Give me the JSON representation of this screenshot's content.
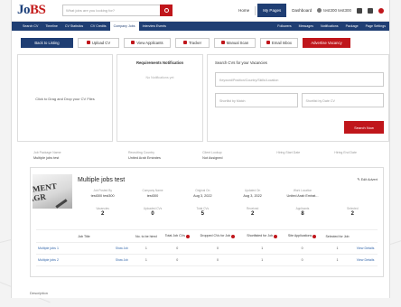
{
  "header": {
    "logo_prefix": "Jo",
    "logo_accent": "BS",
    "search_placeholder": "What jobs are you looking for?",
    "nav": [
      "Home",
      "My Pages",
      "Dashboard"
    ],
    "active_nav": "My Pages",
    "user_name": "test300 test300"
  },
  "subnav": {
    "left": [
      "Search CV",
      "Timeline",
      "CV Statistics",
      "CV Credits",
      "Company Jobs",
      "Interview Events"
    ],
    "active": "Company Jobs",
    "right": [
      "Followers",
      "Messages",
      "Notifications",
      "Package",
      "Page Settings"
    ]
  },
  "actions": {
    "back": "Back to Listing",
    "upload": "Upload CV",
    "view_applicants": "View Applicants",
    "tracker": "Tracker",
    "manual_scan": "Manual Scan",
    "email_inbox": "Email Inbox",
    "advertise": "Advertise Vacancy"
  },
  "panels": {
    "drop_text": "Click to Drag and Drop your CV Files",
    "notif_title": "Requirements Notification",
    "notif_empty": "No Notifications yet",
    "search_title": "Search CVs for your Vacancies",
    "keyword_placeholder": "Keyword/Position/Country/Skills/Location",
    "from_placeholder": "Shortlist by Match",
    "to_placeholder": "Shortlist by Date CV",
    "search_button": "Search Now"
  },
  "strip": [
    {
      "label": "Job Package Name",
      "value": "Multiple jobs test"
    },
    {
      "label": "Recruiting Country",
      "value": "United Arab Emirates"
    },
    {
      "label": "Client Lookup",
      "value": "Not Assigned"
    },
    {
      "label": "Hiring Start Date",
      "value": ""
    },
    {
      "label": "Hiring End Date",
      "value": ""
    }
  ],
  "job": {
    "title": "Multiple jobs test",
    "edit": "Edit Advert",
    "thumb_text": "YMENT AGR",
    "meta": [
      {
        "label": "Job Posted By",
        "value": "test300 test300"
      },
      {
        "label": "Company Name",
        "value": "test300"
      },
      {
        "label": "Original On",
        "value": "Aug 3, 2022"
      },
      {
        "label": "Updated On",
        "value": "Aug 3, 2022"
      },
      {
        "label": "Work Location",
        "value": "United Arab Emirat..."
      }
    ],
    "counts": [
      {
        "label": "Vacancies",
        "value": "2"
      },
      {
        "label": "Uploaded CVs",
        "value": "0"
      },
      {
        "label": "Total CVs",
        "value": "5"
      },
      {
        "label": "Received",
        "value": "2"
      },
      {
        "label": "Applicants",
        "value": "8"
      },
      {
        "label": "Selected",
        "value": "2"
      }
    ],
    "table": {
      "headers": [
        "Job Title",
        "No. to be hired",
        "Total Job CVs",
        "Dropped CVs for Job",
        "Shortlisted for Job",
        "Site Applications",
        "Selected for Job",
        ""
      ],
      "rows": [
        {
          "title": "Multiple jobs 1",
          "show": "Show Job",
          "hired": "1",
          "total": "0",
          "dropped": "0",
          "short": "1",
          "site": "0",
          "selected": "1",
          "action": "View Details"
        },
        {
          "title": "Multiple jobs 2",
          "show": "Show Job",
          "hired": "1",
          "total": "0",
          "dropped": "0",
          "short": "1",
          "site": "0",
          "selected": "1",
          "action": "View Details"
        }
      ]
    }
  },
  "footer_text": "Description"
}
